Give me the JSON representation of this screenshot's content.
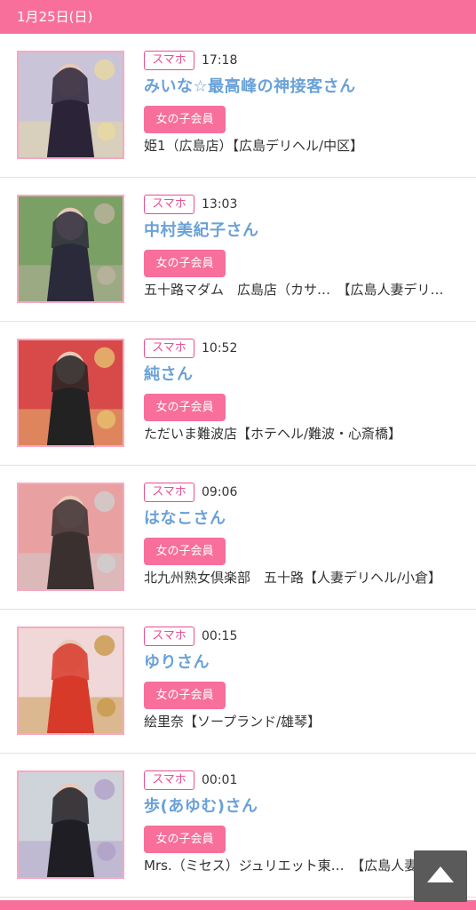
{
  "date_header": "1月25日(日)",
  "entries": [
    {
      "device": "スマホ",
      "time": "17:18",
      "name": "みいな☆最高峰の神接客さん",
      "member": "女の子会員",
      "shop": "姫1（広島店）【広島デリヘル/中区】",
      "thumb": {
        "bg": "#c9c4d8",
        "figure": "#2b2438",
        "accent": "#e8d9a0"
      }
    },
    {
      "device": "スマホ",
      "time": "13:03",
      "name": "中村美紀子さん",
      "member": "女の子会員",
      "shop": "五十路マダム　広島店（カサ…　【広島人妻デリ…",
      "thumb": {
        "bg": "#7aa066",
        "figure": "#2a2a3a",
        "accent": "#bdb3a0"
      }
    },
    {
      "device": "スマホ",
      "time": "10:52",
      "name": "純さん",
      "member": "女の子会員",
      "shop": "ただいま難波店【ホテヘル/難波・心斎橋】",
      "thumb": {
        "bg": "#d84a4a",
        "figure": "#222222",
        "accent": "#e6c070"
      }
    },
    {
      "device": "スマホ",
      "time": "09:06",
      "name": "はなこさん",
      "member": "女の子会員",
      "shop": "北九州熟女倶楽部　五十路【人妻デリヘル/小倉】",
      "thumb": {
        "bg": "#e8a0a0",
        "figure": "#3a3030",
        "accent": "#d0d0d0"
      }
    },
    {
      "device": "スマホ",
      "time": "00:15",
      "name": "ゆりさん",
      "member": "女の子会員",
      "shop": "絵里奈【ソープランド/雄琴】",
      "thumb": {
        "bg": "#f0d8d8",
        "figure": "#d83a2a",
        "accent": "#c89848"
      }
    },
    {
      "device": "スマホ",
      "time": "00:01",
      "name": "歩(あゆむ)さん",
      "member": "女の子会員",
      "shop": "Mrs.（ミセス）ジュリエット東…　【広島人妻デ",
      "thumb": {
        "bg": "#cfd3da",
        "figure": "#1e1e24",
        "accent": "#b0a0c8"
      }
    }
  ],
  "icons": {
    "scroll_top": "triangle-up-icon"
  },
  "colors": {
    "brand": "#f76f9a",
    "name_link": "#6aa1d8",
    "badge_border": "#e84f8f"
  }
}
